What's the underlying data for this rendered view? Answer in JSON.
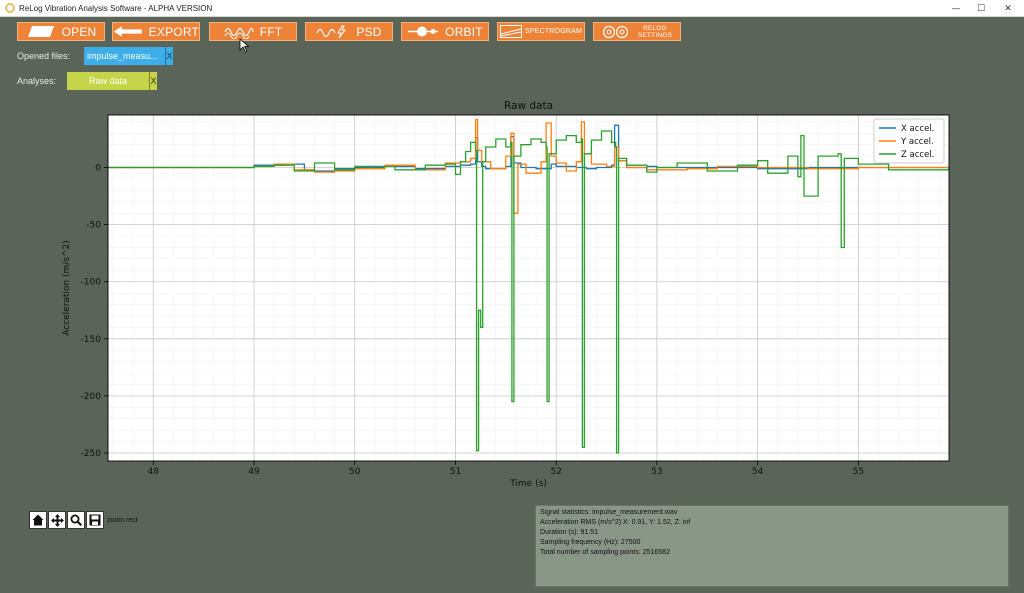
{
  "window": {
    "title": "ReLog Vibration Analysis Software - ALPHA VERSION",
    "minimize": "—",
    "maximize": "☐",
    "close": "✕"
  },
  "toolbar": {
    "open": "OPEN",
    "export": "EXPORT",
    "fft": "FFT",
    "psd": "PSD",
    "orbit": "ORBIT",
    "spectrogram": "SPECTROGRAM",
    "relog_settings_1": "RELOG",
    "relog_settings_2": "SETTINGS",
    "button_color": "#ee8236"
  },
  "files": {
    "label": "Opened files:",
    "items": [
      {
        "name": "impulse_measu...",
        "close": "X"
      }
    ]
  },
  "analyses": {
    "label": "Analyses:",
    "items": [
      {
        "name": "Raw data",
        "close": "X"
      }
    ]
  },
  "chart_data": {
    "type": "line",
    "title": "Raw data",
    "xlabel": "Time (s)",
    "ylabel": "Acceleration (m/s^2)",
    "xlim": [
      47.55,
      55.9
    ],
    "ylim": [
      -257,
      46
    ],
    "xticks": [
      48,
      49,
      50,
      51,
      52,
      53,
      54,
      55
    ],
    "yticks": [
      0,
      -50,
      -100,
      -150,
      -200,
      -250
    ],
    "grid": true,
    "minor_grid": true,
    "legend_position": "top-right",
    "series": [
      {
        "name": "X accel.",
        "color": "#1f77b4",
        "x": [
          47.55,
          48.8,
          49.0,
          49.3,
          49.5,
          49.6,
          49.8,
          50.0,
          50.3,
          50.6,
          50.9,
          51.05,
          51.15,
          51.2,
          51.22,
          51.26,
          51.3,
          51.5,
          51.55,
          51.58,
          51.65,
          51.8,
          51.95,
          52.0,
          52.2,
          52.3,
          52.4,
          52.55,
          52.58,
          52.62,
          52.7,
          52.9,
          53.0,
          53.5,
          54.0,
          54.5,
          55.0,
          55.9
        ],
        "y": [
          0,
          0,
          2,
          3,
          -2,
          -3,
          -1,
          0,
          1,
          -1,
          1,
          2,
          3,
          26,
          5,
          1,
          -1,
          1,
          27,
          4,
          0,
          -1,
          3,
          1,
          0,
          -1,
          0,
          2,
          37,
          6,
          0,
          1,
          0,
          0,
          -1,
          0,
          0,
          0
        ]
      },
      {
        "name": "Y accel.",
        "color": "#ff7f0e",
        "x": [
          47.55,
          48.8,
          49.0,
          49.2,
          49.4,
          49.6,
          49.8,
          50.0,
          50.3,
          50.6,
          50.9,
          51.05,
          51.15,
          51.2,
          51.22,
          51.26,
          51.35,
          51.5,
          51.55,
          51.58,
          51.62,
          51.7,
          51.85,
          51.9,
          51.95,
          52.0,
          52.1,
          52.2,
          52.25,
          52.28,
          52.35,
          52.5,
          52.58,
          52.62,
          52.7,
          52.9,
          53.3,
          53.6,
          54.0,
          54.5,
          55.0,
          55.9
        ],
        "y": [
          0,
          0,
          1,
          3,
          -2,
          -4,
          -3,
          -1,
          2,
          -2,
          4,
          5,
          8,
          42,
          15,
          5,
          -1,
          10,
          30,
          -40,
          3,
          -5,
          5,
          39,
          10,
          4,
          -3,
          5,
          40,
          12,
          3,
          1,
          18,
          6,
          0,
          -2,
          -1,
          1,
          0,
          -1,
          0,
          0
        ]
      },
      {
        "name": "Z accel.",
        "color": "#2ca02c",
        "x": [
          47.55,
          48.8,
          49.0,
          49.2,
          49.4,
          49.6,
          49.8,
          50.0,
          50.4,
          50.7,
          50.9,
          51.0,
          51.05,
          51.1,
          51.15,
          51.2,
          51.21,
          51.23,
          51.25,
          51.27,
          51.3,
          51.4,
          51.5,
          51.55,
          51.56,
          51.58,
          51.65,
          51.75,
          51.85,
          51.9,
          51.91,
          51.93,
          52.0,
          52.1,
          52.2,
          52.25,
          52.26,
          52.28,
          52.35,
          52.45,
          52.55,
          52.59,
          52.6,
          52.62,
          52.7,
          52.9,
          53.0,
          53.2,
          53.5,
          53.8,
          54.0,
          54.1,
          54.3,
          54.4,
          54.43,
          54.46,
          54.6,
          54.8,
          54.83,
          54.86,
          55.0,
          55.3,
          55.9
        ],
        "y": [
          0,
          0,
          1,
          2,
          -3,
          4,
          -2,
          1,
          -2,
          2,
          3,
          -6,
          5,
          14,
          22,
          15,
          -248,
          -125,
          -140,
          5,
          18,
          25,
          18,
          22,
          -205,
          10,
          20,
          25,
          22,
          18,
          -205,
          12,
          24,
          28,
          22,
          25,
          -245,
          12,
          24,
          32,
          22,
          18,
          -250,
          8,
          2,
          -4,
          0,
          4,
          -3,
          2,
          6,
          -5,
          10,
          -8,
          28,
          -25,
          10,
          12,
          -70,
          8,
          3,
          -2,
          0
        ]
      }
    ]
  },
  "nav_toolbar": {
    "mode_label": "zoom rect"
  },
  "stats": {
    "lines": [
      "Signal statistics: impulse_measurement.wav",
      "Acceleration RMS (m/s^2) X: 0.91, Y: 1.52, Z: inf",
      "Duration (s): 91.51",
      "Sampling frequency (Hz): 27500",
      "Total number of sampling points: 2516582"
    ]
  }
}
